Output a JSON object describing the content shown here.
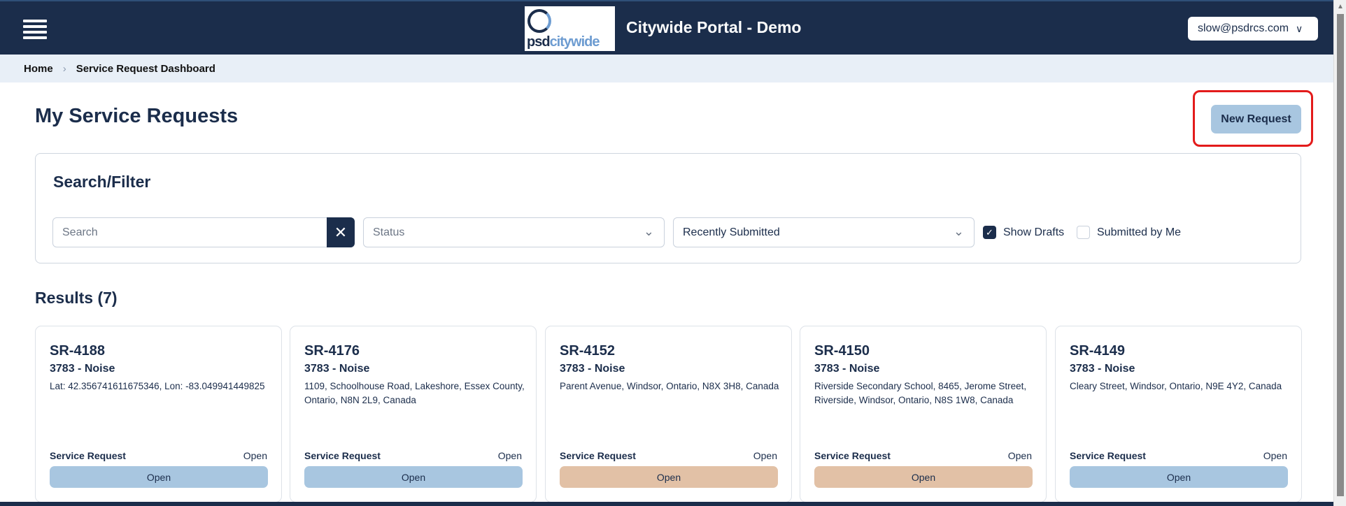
{
  "header": {
    "app_title": "Citywide Portal - Demo",
    "logo_text_1": "psd",
    "logo_text_2": "citywide",
    "user_email": "slow@psdrcs.com",
    "menu_icon": "hamburger-icon"
  },
  "breadcrumb": {
    "home": "Home",
    "current": "Service Request Dashboard"
  },
  "page": {
    "title": "My Service Requests",
    "new_request_label": "New Request"
  },
  "filter": {
    "title": "Search/Filter",
    "search_placeholder": "Search",
    "status_placeholder": "Status",
    "sort_value": "Recently Submitted",
    "show_drafts_label": "Show Drafts",
    "show_drafts_checked": true,
    "submitted_by_me_label": "Submitted by Me",
    "submitted_by_me_checked": false
  },
  "results": {
    "label": "Results (7)"
  },
  "colors": {
    "primary": "#1b2d4b",
    "pill_blue": "#a8c6e0",
    "pill_tan": "#e2c1a6",
    "highlight": "#e31b1b"
  },
  "cards": [
    {
      "id": "SR-4188",
      "type": "3783 - Noise",
      "address": "Lat: 42.356741611675346, Lon: -83.049941449825",
      "category": "Service Request",
      "status": "Open",
      "pill": "Open",
      "pill_color": "#a8c6e0"
    },
    {
      "id": "SR-4176",
      "type": "3783 - Noise",
      "address": "1109, Schoolhouse Road, Lakeshore, Essex County, Ontario, N8N 2L9, Canada",
      "category": "Service Request",
      "status": "Open",
      "pill": "Open",
      "pill_color": "#a8c6e0"
    },
    {
      "id": "SR-4152",
      "type": "3783 - Noise",
      "address": "Parent Avenue, Windsor, Ontario, N8X 3H8, Canada",
      "category": "Service Request",
      "status": "Open",
      "pill": "Open",
      "pill_color": "#e2c1a6"
    },
    {
      "id": "SR-4150",
      "type": "3783 - Noise",
      "address": "Riverside Secondary School, 8465, Jerome Street, Riverside, Windsor, Ontario, N8S 1W8, Canada",
      "category": "Service Request",
      "status": "Open",
      "pill": "Open",
      "pill_color": "#e2c1a6"
    },
    {
      "id": "SR-4149",
      "type": "3783 - Noise",
      "address": "Cleary Street, Windsor, Ontario, N9E 4Y2, Canada",
      "category": "Service Request",
      "status": "Open",
      "pill": "Open",
      "pill_color": "#a8c6e0"
    }
  ]
}
